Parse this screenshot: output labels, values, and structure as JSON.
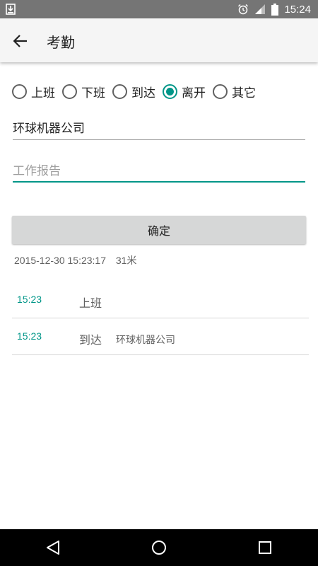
{
  "status_bar": {
    "time": "15:24"
  },
  "toolbar": {
    "title": "考勤"
  },
  "radio_options": [
    {
      "label": "上班",
      "checked": false
    },
    {
      "label": "下班",
      "checked": false
    },
    {
      "label": "到达",
      "checked": false
    },
    {
      "label": "离开",
      "checked": true
    },
    {
      "label": "其它",
      "checked": false
    }
  ],
  "form": {
    "company_value": "环球机器公司",
    "report_placeholder": "工作报告",
    "confirm_label": "确定"
  },
  "info": {
    "datetime": "2015-12-30 15:23:17",
    "distance": "31米"
  },
  "records": [
    {
      "time": "15:23",
      "type": "上班",
      "location": ""
    },
    {
      "time": "15:23",
      "type": "到达",
      "location": "环球机器公司"
    }
  ],
  "colors": {
    "accent": "#009688",
    "status_bar": "#757575",
    "toolbar": "#f5f5f5",
    "button": "#d6d7d7"
  }
}
